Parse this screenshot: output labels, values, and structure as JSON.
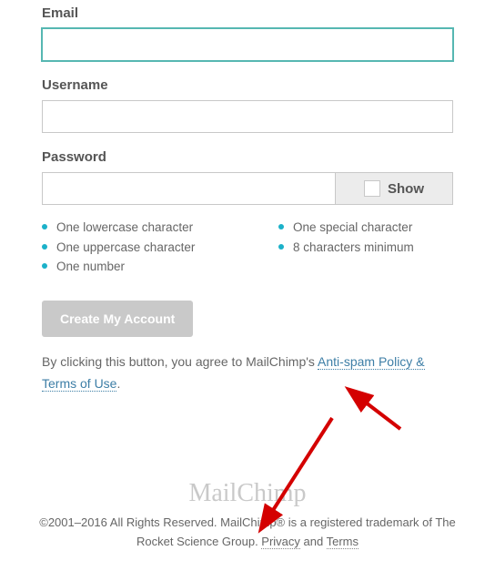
{
  "form": {
    "email_label": "Email",
    "email_value": "",
    "username_label": "Username",
    "username_value": "",
    "password_label": "Password",
    "password_value": "",
    "show_label": "Show",
    "requirements_col1": [
      "One lowercase character",
      "One uppercase character",
      "One number"
    ],
    "requirements_col2": [
      "One special character",
      "8 characters minimum"
    ],
    "submit_label": "Create My Account",
    "consent_prefix": "By clicking this button, you agree to MailChimp's ",
    "consent_link": "Anti-spam Policy & Terms of Use",
    "consent_suffix": "."
  },
  "footer": {
    "brand": "MailChimp",
    "copy_pre": "©2001–2016 All Rights Reserved. MailChimp® is a registered trademark of The Rocket Science Group. ",
    "privacy": "Privacy",
    "and": " and ",
    "terms": "Terms"
  }
}
